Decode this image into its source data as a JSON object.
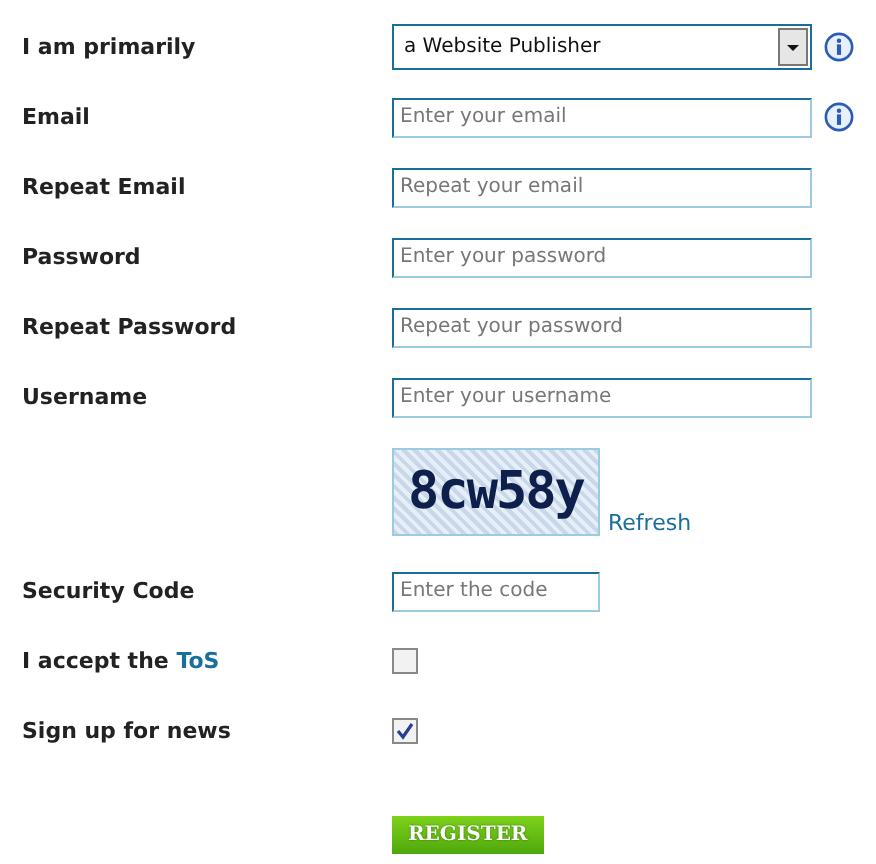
{
  "fields": [
    {
      "kind": "select",
      "label": "I am primarily",
      "value": "a Website Publisher",
      "info": true
    },
    {
      "kind": "text",
      "label": "Email",
      "placeholder": "Enter your email",
      "info": true
    },
    {
      "kind": "text",
      "label": "Repeat Email",
      "placeholder": "Repeat your email",
      "info": false
    },
    {
      "kind": "text",
      "label": "Password",
      "placeholder": "Enter your password",
      "info": false
    },
    {
      "kind": "text",
      "label": "Repeat Password",
      "placeholder": "Repeat your password",
      "info": false
    },
    {
      "kind": "text",
      "label": "Username",
      "placeholder": "Enter your username",
      "info": false
    },
    {
      "kind": "captcha",
      "code": "8cw58y",
      "link": "Refresh"
    },
    {
      "kind": "short",
      "label": "Security Code",
      "placeholder": "Enter the code",
      "info": false
    },
    {
      "kind": "checkbox",
      "label": "I accept the",
      "link": "ToS",
      "checked": false
    },
    {
      "kind": "checkbox",
      "label": "Sign up for news",
      "checked": true
    }
  ],
  "submit": "REGISTER"
}
